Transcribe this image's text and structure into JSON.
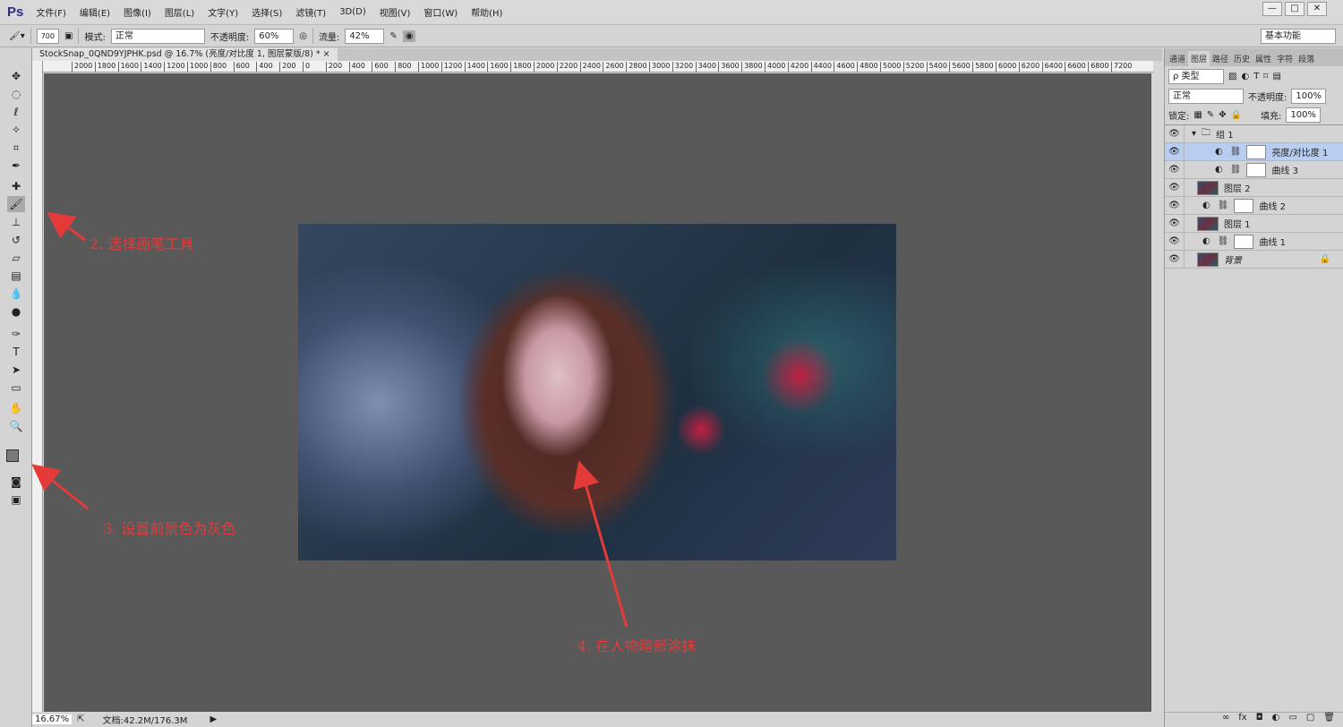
{
  "app": {
    "logo": "Ps",
    "menu": [
      "文件(F)",
      "编辑(E)",
      "图像(I)",
      "图层(L)",
      "文字(Y)",
      "选择(S)",
      "滤镜(T)",
      "3D(D)",
      "视图(V)",
      "窗口(W)",
      "帮助(H)"
    ],
    "window_buttons": [
      "—",
      "□",
      "✕"
    ]
  },
  "options": {
    "brush_size": "700",
    "mode_label": "模式:",
    "mode_value": "正常",
    "opacity_label": "不透明度:",
    "opacity_value": "60%",
    "flow_label": "流量:",
    "flow_value": "42%",
    "workspace": "基本功能"
  },
  "document": {
    "tab_title": "StockSnap_0QND9YJPHK.psd @ 16.7% (亮度/对比度 1, 图层蒙版/8) *",
    "close": "×",
    "ruler_labels": [
      "2000",
      "1800",
      "1600",
      "1400",
      "1200",
      "1000",
      "800",
      "600",
      "400",
      "200",
      "0",
      "200",
      "400",
      "600",
      "800",
      "1000",
      "1200",
      "1400",
      "1600",
      "1800",
      "2000",
      "2200",
      "2400",
      "2600",
      "2800",
      "3000",
      "3200",
      "3400",
      "3600",
      "3800",
      "4000",
      "4200",
      "4400",
      "4600",
      "4800",
      "5000",
      "5200",
      "5400",
      "5600",
      "5800",
      "6000",
      "6200",
      "6400",
      "6600",
      "6800",
      "7200"
    ]
  },
  "status": {
    "zoom": "16.67%",
    "doc_info": "文档:42.2M/176.3M"
  },
  "panel": {
    "tabs": [
      "通道",
      "图层",
      "路径",
      "历史",
      "属性",
      "字符",
      "段落"
    ],
    "active_tab": 1,
    "filter_kind": "ρ 类型",
    "blend_mode": "正常",
    "opacity_label": "不透明度:",
    "opacity_value": "100%",
    "lock_label": "锁定:",
    "fill_label": "填充:",
    "fill_value": "100%",
    "layers": [
      {
        "name": "组 1",
        "type": "group",
        "indent": 0
      },
      {
        "name": "亮度/对比度 1",
        "type": "adjust",
        "indent": 1,
        "selected": true
      },
      {
        "name": "曲线 3",
        "type": "adjust",
        "indent": 1
      },
      {
        "name": "图层 2",
        "type": "pixel",
        "indent": 0
      },
      {
        "name": "曲线 2",
        "type": "adjust",
        "indent": 0
      },
      {
        "name": "图层 1",
        "type": "pixel",
        "indent": 0
      },
      {
        "name": "曲线 1",
        "type": "adjust",
        "indent": 0
      },
      {
        "name": "背景",
        "type": "background",
        "indent": 0,
        "locked": true
      }
    ]
  },
  "annotations": {
    "step2": "2. 选择画笔工具",
    "step3": "3. 设置前景色为灰色",
    "step4": "4. 在人物暗部涂抹"
  },
  "colors": {
    "annotation": "#e53a3a",
    "canvas": "#595959",
    "selected_layer": "#b8cdf0"
  }
}
